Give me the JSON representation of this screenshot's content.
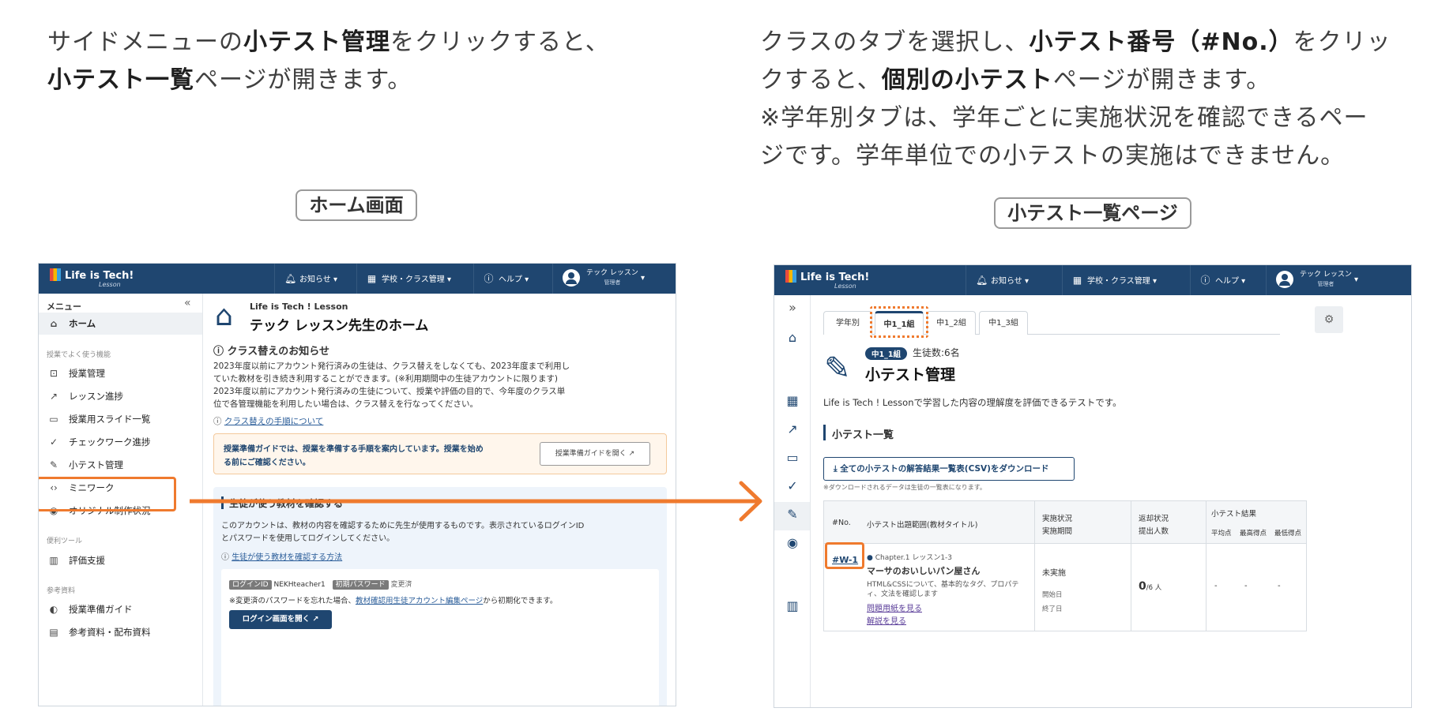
{
  "captions": {
    "left_line1_a": "サイドメニューの",
    "left_line1_b": "小テスト管理",
    "left_line1_c": "をクリックすると、",
    "left_line2_a": "小テスト一覧",
    "left_line2_b": "ページが開きます。",
    "right_line1_a": "クラスのタブを選択し、",
    "right_line1_b": "小テスト番号（#No.）",
    "right_line1_c": "をクリッ",
    "right_line2_a": "クすると、",
    "right_line2_b": "個別の小テスト",
    "right_line2_c": "ページが開きます。",
    "right_line3": "※学年別タブは、学年ごとに実施状況を確認できるペー",
    "right_line4": "ジです。学年単位での小テストの実施はできません。"
  },
  "labels": {
    "home_screen": "ホーム画面",
    "quiz_list_page": "小テスト一覧ページ"
  },
  "topbar": {
    "logo": "Life is Tech!",
    "logo_sub": "Lesson",
    "notifications": "お知らせ",
    "school_class": "学校・クラス管理",
    "help": "ヘルプ",
    "user_name": "テック レッスン",
    "user_role": "管理者"
  },
  "sidebar": {
    "menu_title": "メニュー",
    "home": "ホーム",
    "group1": "授業でよく使う機能",
    "items1": [
      "授業管理",
      "レッスン進捗",
      "授業用スライド一覧",
      "チェックワーク進捗",
      "小テスト管理",
      "ミニワーク",
      "オリジナル制作状況"
    ],
    "group2": "便利ツール",
    "items2": [
      "評価支援"
    ],
    "group3": "参考資料",
    "items3": [
      "授業準備ガイド",
      "参考資料・配布資料"
    ]
  },
  "home": {
    "subtitle": "Life is Tech ! Lesson",
    "title": "テック レッスン先生のホーム",
    "notice_title": "クラス替えのお知らせ",
    "notice_l1": "2023年度以前にアカウント発行済みの生徒は、クラス替えをしなくても、2023年度まで利用し",
    "notice_l2": "ていた教材を引き続き利用することができます。(※利用期間中の生徒アカウントに限ります)",
    "notice_l3": "2023年度以前にアカウント発行済みの生徒について、授業や評価の目的で、今年度のクラス単",
    "notice_l4": "位で各管理機能を利用したい場合は、クラス替えを行なってください。",
    "notice_link": "クラス替えの手順について",
    "guide_l1": "授業準備ガイドでは、授業を準備する手順を案内しています。授業を始め",
    "guide_l2": "る前にご確認ください。",
    "guide_button": "授業準備ガイドを開く",
    "materials_title": "生徒が使う教材を確認する",
    "materials_l1": "このアカウントは、教材の内容を確認するために先生が使用するものです。表示されているログインID",
    "materials_l2": "とパスワードを使用してログインしてください。",
    "materials_link": "生徒が使う教材を確認する方法",
    "login_id_label": "ログインID",
    "login_id": "NEKHteacher1",
    "init_pw_label": "初期パスワード",
    "init_pw": "変更済",
    "pw_note_a": "※変更済のパスワードを忘れた場合、",
    "pw_note_link": "教材確認用生徒アカウント編集ページ",
    "pw_note_b": "から初期化できます。",
    "login_button": "ログイン画面を開く"
  },
  "quiz": {
    "tabs": [
      "学年別",
      "中1_1組",
      "中1_2組",
      "中1_3組"
    ],
    "class_badge": "中1_1組",
    "student_count": "生徒数:6名",
    "title": "小テスト管理",
    "description": "Life is Tech ! Lessonで学習した内容の理解度を評価できるテストです。",
    "list_title": "小テスト一覧",
    "csv_button": "全ての小テストの解答結果一覧表(CSV)をダウンロード",
    "csv_note": "※ダウンロードされるデータは生徒の一覧表になります。",
    "headers": {
      "no": "#No.",
      "range": "小テスト出題範囲(教材タイトル)",
      "status1": "実施状況",
      "status2": "実施期間",
      "return1": "返却状況",
      "return2": "提出人数",
      "result": "小テスト結果",
      "avg": "平均点",
      "max": "最高得点",
      "min": "最低得点"
    },
    "row": {
      "no": "#W-1",
      "chapter": "Chapter.1 レッスン1-3",
      "name": "マーサのおいしいパン屋さん",
      "desc1": "HTML&CSSについて、基本的なタグ、プロパテ",
      "desc2": "ィ、文法を確認します",
      "link1": "問題用紙を見る",
      "link2": "解説を見る",
      "status": "未実施",
      "start": "開始日",
      "end": "終了日",
      "submitted": "0",
      "of": "/6 人",
      "avg": "-",
      "max": "-",
      "min": "-"
    }
  },
  "colors": {
    "navy": "#1f4670",
    "orange": "#ef7a2e"
  }
}
